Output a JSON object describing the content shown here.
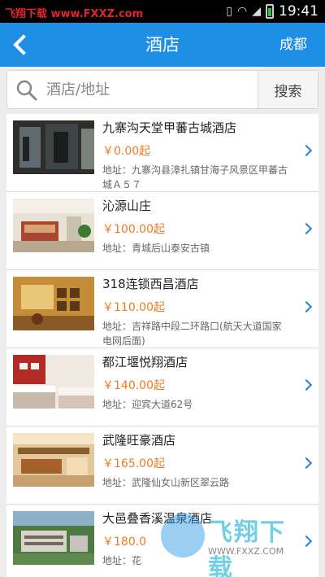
{
  "status_bar": {
    "watermark": "飞翔下载 www.FXXZ.com",
    "time": "19:41",
    "colors": {
      "watermark": "#e0252b"
    }
  },
  "nav": {
    "title": "酒店",
    "city": "成都",
    "color": "#1f8ee5"
  },
  "search": {
    "placeholder": "酒店/地址",
    "button": "搜索"
  },
  "hotels": [
    {
      "name": "九寨沟天堂甲蕃古城酒店",
      "price": "￥0.00起",
      "address": "地址：九寨沟县漳扎镇甘海子风景区甲蕃古城Ａ５７"
    },
    {
      "name": "沁源山庄",
      "price": "￥100.00起",
      "address": "地址：青城后山泰安古镇"
    },
    {
      "name": "318连锁西昌酒店",
      "price": "￥110.00起",
      "address": "地址：吉祥路中段二环路口(航天大道国家电网后面)"
    },
    {
      "name": "都江堰悦翔酒店",
      "price": "￥140.00起",
      "address": "地址：迎宾大道62号"
    },
    {
      "name": "武隆旺豪酒店",
      "price": "￥165.00起",
      "address": "地址：武隆仙女山新区翠云路"
    },
    {
      "name": "大邑叠香溪温泉酒店",
      "price": "￥180.0",
      "address": "地址：花"
    }
  ],
  "watermark_bottom": {
    "text": "飞翔下载",
    "url": "WWW.FXXZ.COM"
  },
  "accent": {
    "price": "#f07a22",
    "chevron": "#2b7fd0"
  }
}
